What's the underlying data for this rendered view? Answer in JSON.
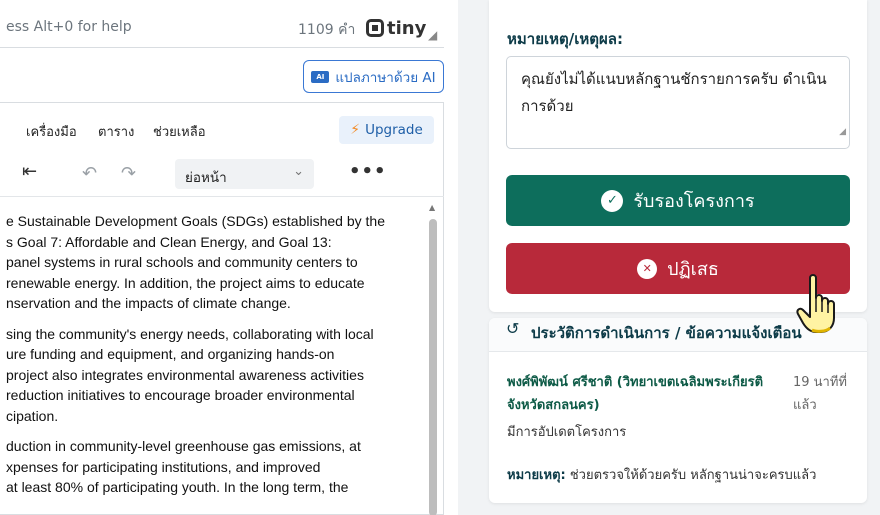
{
  "editor": {
    "status_hint": "ess Alt+0 for help",
    "word_count": "1109 คำ",
    "brand": "tiny",
    "ai_button_label": "แปลภาษาด้วย AI",
    "ai_icon_text": "AI",
    "menu": [
      "เครื่องมือ",
      "ตาราง",
      "ช่วยเหลือ"
    ],
    "upgrade_label": "Upgrade",
    "paragraph_style": "ย่อหน้า",
    "content_lines": [
      [
        "e Sustainable Development Goals (SDGs) established by the",
        "s Goal 7: Affordable and Clean Energy, and Goal 13:",
        "panel systems in rural schools and community centers to",
        "renewable energy. In addition, the project aims to educate",
        "nservation and the impacts of climate change."
      ],
      [
        "sing the community's energy needs, collaborating with local",
        "ure funding and equipment, and organizing hands-on",
        "project also integrates environmental awareness activities",
        "reduction initiatives to encourage broader environmental",
        "cipation."
      ],
      [
        "duction in community-level greenhouse gas emissions, at",
        "xpenses for participating institutions, and improved",
        "at least 80% of participating youth. In the long term, the"
      ]
    ]
  },
  "review": {
    "note_label": "หมายเหตุ/เหตุผล:",
    "note_value": "คุณยังไม่ได้แนบหลักฐานชักรายการครับ ดำเนินการด้วย",
    "approve_label": "รับรองโครงการ",
    "reject_label": "ปฏิเสธ"
  },
  "history": {
    "title": "ประวัติการดำเนินการ / ข้อความแจ้งเตือน",
    "author": "พงศ์พิพัฒน์ ศรีชาติ (วิทยาเขตเฉลิมพระเกียรติ จังหวัดสกลนคร)",
    "time_ago": "19 นาทีที่แล้ว",
    "action": "มีการอัปเดตโครงการ",
    "remark_label": "หมายเหตุ:",
    "remark_text": " ช่วยตรวจให้ด้วยครับ หลักฐานน่าจะครบแล้ว"
  },
  "colors": {
    "approve": "#0d6e5c",
    "reject": "#b8293a",
    "accent_blue": "#2b6cc4"
  }
}
